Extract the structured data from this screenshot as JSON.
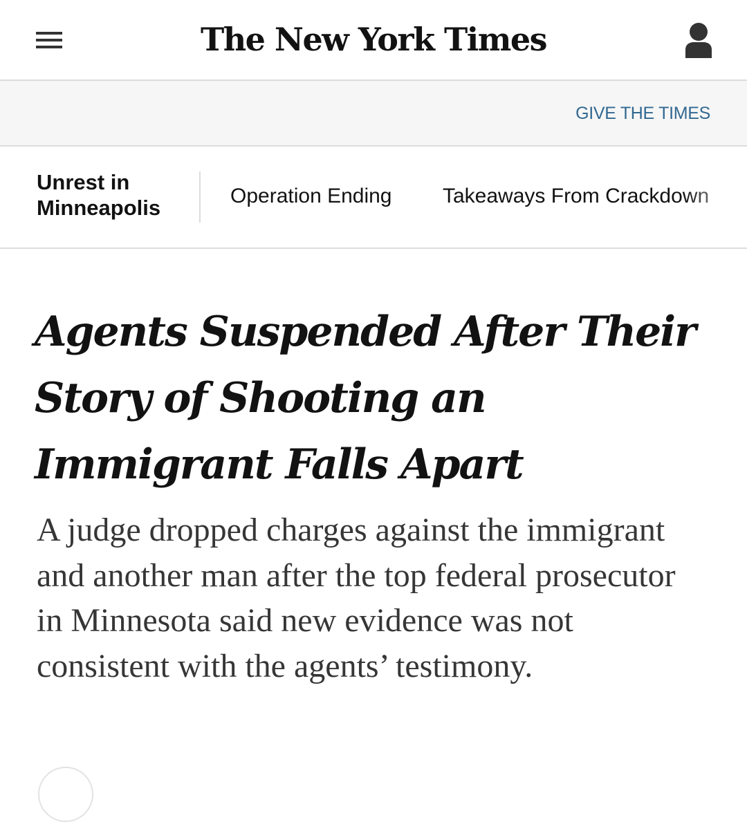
{
  "masthead": {
    "logo_text": "The New York Times",
    "menu_icon": "hamburger-menu-icon",
    "account_icon": "user-account-icon"
  },
  "promo": {
    "give_label": "GIVE THE TIMES"
  },
  "topic_nav": {
    "title": "Unrest in Minneapolis",
    "links": [
      {
        "label": "Operation Ending"
      },
      {
        "label": "Takeaways From Crackdown"
      }
    ]
  },
  "article": {
    "headline": "Agents Suspended After Their Story of Shooting an Immigrant Falls Apart",
    "summary": "A judge dropped charges against the immigrant and another man after the top federal prosecutor in Minnesota said new evidence was not consistent with the agents’ testimony."
  },
  "colors": {
    "text": "#121212",
    "summary_text": "#363636",
    "link_blue": "#326891",
    "divider": "#dcdcdc",
    "promo_background": "#f6f6f6"
  }
}
